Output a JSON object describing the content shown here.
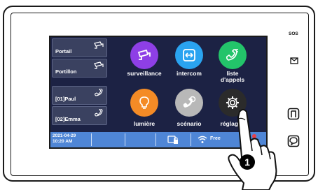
{
  "sidebar": {
    "cameras": [
      {
        "label": "Portail",
        "icon": "cctv-camera-icon"
      },
      {
        "label": "Portillon",
        "icon": "cctv-camera-icon"
      },
      {
        "label": "[01]Paul",
        "icon": "phone-icon"
      },
      {
        "label": "[02]Emma",
        "icon": "phone-icon"
      }
    ]
  },
  "menu": {
    "tiles": [
      {
        "label": "surveillance",
        "icon": "cctv-camera-icon",
        "color": "#8e3fe6"
      },
      {
        "label": "intercom",
        "icon": "intercom-arrows-icon",
        "color": "#2aa3f0"
      },
      {
        "label": "liste\nd'appels",
        "icon": "call-log-icon",
        "color": "#23c46a"
      },
      {
        "label": "lumière",
        "icon": "light-bulb-icon",
        "color": "#f48b26"
      },
      {
        "label": "scénario",
        "icon": "phone-gear-icon",
        "color": "#b8b8b8"
      },
      {
        "label": "réglages",
        "icon": "gear-icon",
        "color": "#2b2b2b"
      }
    ]
  },
  "status_bar": {
    "date": "2021-04-29",
    "time": "10:20 AM",
    "wifi_label": "Free",
    "status_color": "#4f86d6"
  },
  "device": {
    "sos_label": "SOS",
    "callout_number": "1"
  }
}
